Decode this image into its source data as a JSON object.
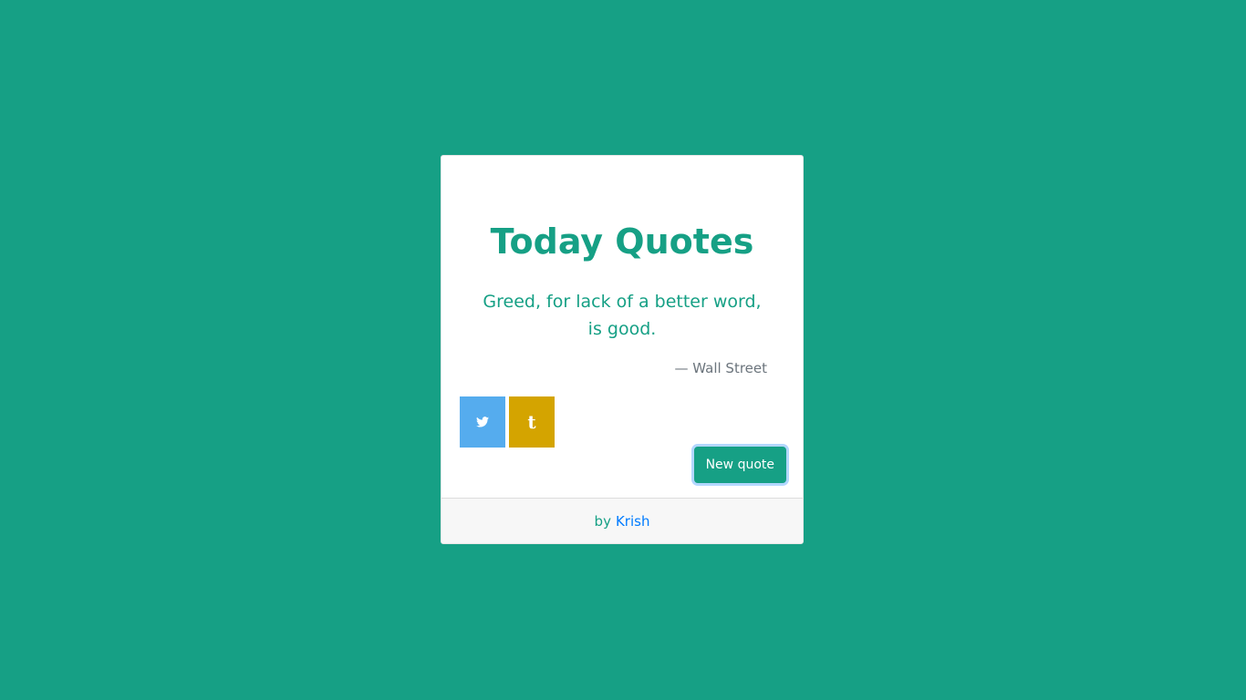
{
  "card": {
    "title": "Today Quotes",
    "quote": "Greed, for lack of a better word, is good.",
    "author": "— Wall Street"
  },
  "share": {
    "twitter_icon": "twitter-icon",
    "tumblr_icon": "tumblr-icon",
    "tumblr_glyph": "t"
  },
  "actions": {
    "new_quote_label": "New quote"
  },
  "footer": {
    "prefix": "by",
    "author_link": "Krish"
  },
  "colors": {
    "background": "#16a085",
    "accent": "#16a085",
    "twitter": "#55acee",
    "tumblr": "#d4a400",
    "link": "#007bff"
  }
}
